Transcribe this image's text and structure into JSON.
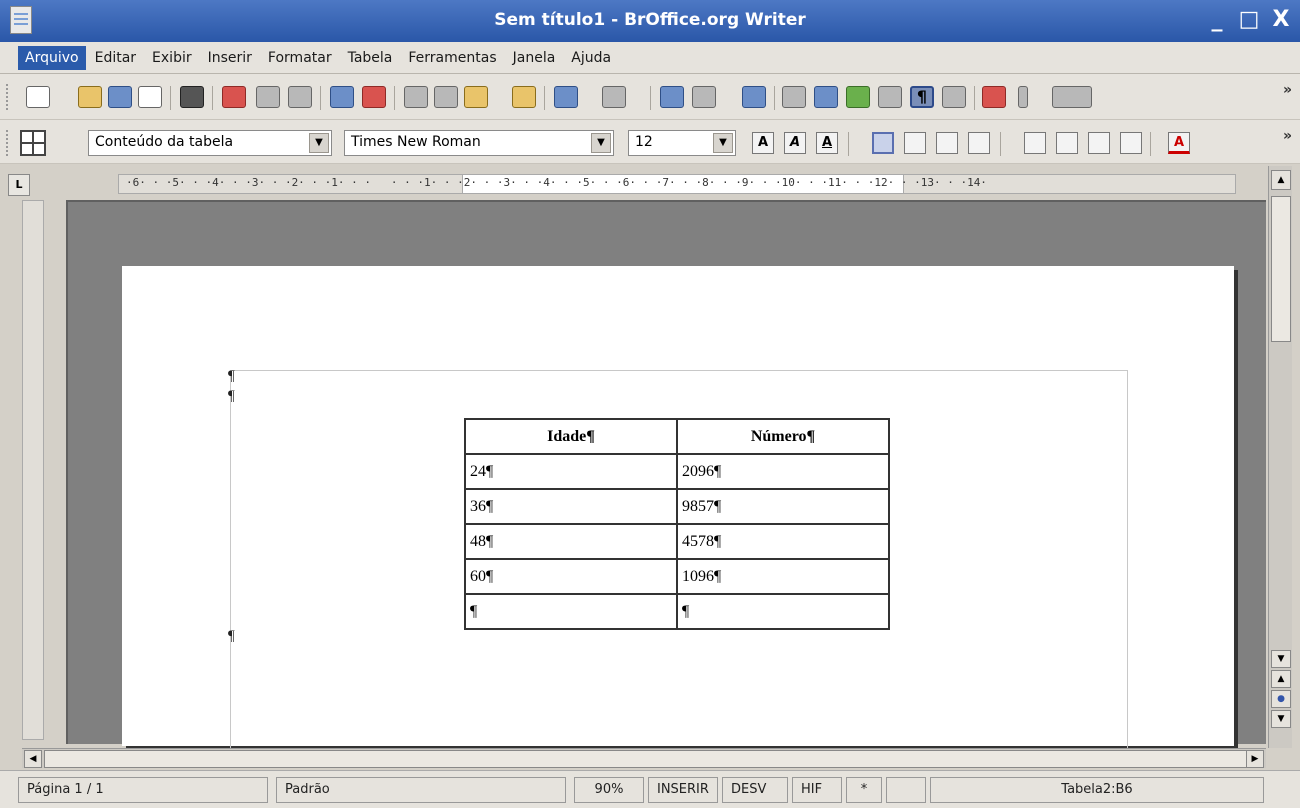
{
  "window": {
    "title": "Sem título1 - BrOffice.org Writer",
    "min": "_",
    "max": "□",
    "close": "X"
  },
  "menu": [
    "Arquivo",
    "Editar",
    "Exibir",
    "Inserir",
    "Formatar",
    "Tabela",
    "Ferramentas",
    "Janela",
    "Ajuda"
  ],
  "format_bar": {
    "style": "Conteúdo da tabela",
    "font": "Times New Roman",
    "size": "12"
  },
  "ruler": {
    "h_ticks": "·6· · ·5· · ·4· · ·3· · ·2· · ·1· · ·   · · ·1· · ·2· · ·3· · ·4· · ·5· · ·6· · ·7· · ·8· · ·9· · ·10· · ·11· · ·12· · ·13· · ·14·",
    "corner": "L"
  },
  "table": {
    "headers": [
      "Idade¶",
      "Número¶"
    ],
    "rows": [
      [
        "24¶",
        "2096¶"
      ],
      [
        "36¶",
        "9857¶"
      ],
      [
        "48¶",
        "4578¶"
      ],
      [
        "60¶",
        "1096¶"
      ],
      [
        "¶",
        "¶"
      ]
    ]
  },
  "pilcrow": "¶",
  "status": {
    "page": "Página 1 / 1",
    "style": "Padrão",
    "zoom": "90%",
    "insert": "INSERIR",
    "sel": "DESV",
    "hyp": "HIF",
    "modified": "*",
    "cell": "Tabela2:B6"
  },
  "toolbar": {
    "more": "»"
  }
}
